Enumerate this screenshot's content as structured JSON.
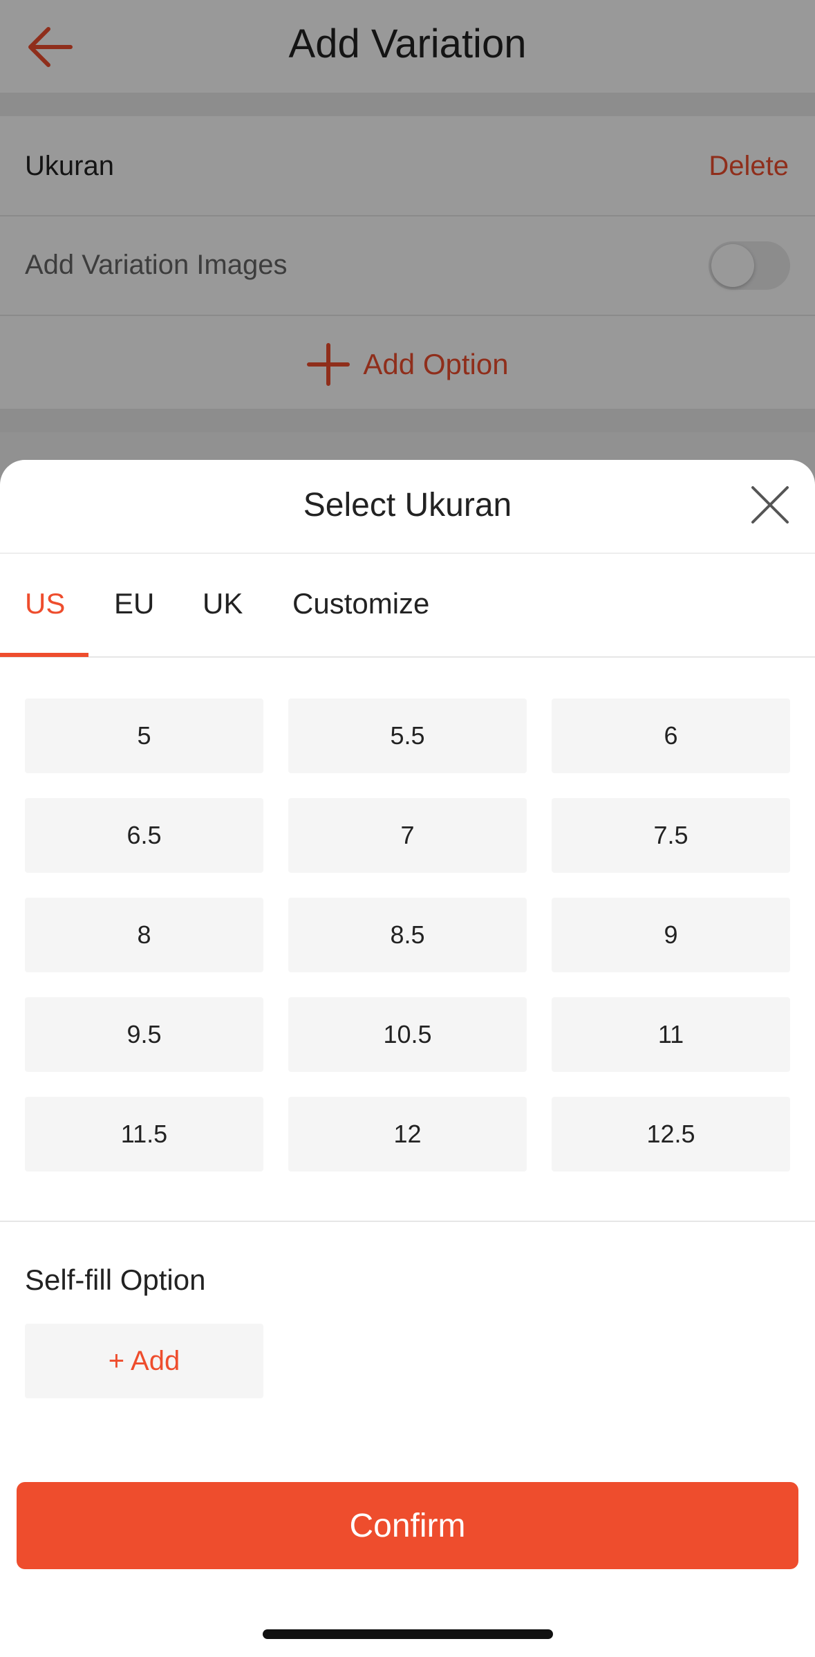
{
  "header": {
    "title": "Add Variation",
    "back_icon": "arrow-left-icon"
  },
  "variation": {
    "name": "Ukuran",
    "delete_label": "Delete",
    "images_label": "Add Variation Images",
    "images_toggle_on": false,
    "add_option_label": "Add Option"
  },
  "sheet": {
    "title": "Select Ukuran",
    "close_icon": "close-icon",
    "tabs": [
      {
        "label": "US",
        "active": true
      },
      {
        "label": "EU",
        "active": false
      },
      {
        "label": "UK",
        "active": false
      },
      {
        "label": "Customize",
        "active": false
      }
    ],
    "sizes": [
      "5",
      "5.5",
      "6",
      "6.5",
      "7",
      "7.5",
      "8",
      "8.5",
      "9",
      "9.5",
      "10.5",
      "11",
      "11.5",
      "12",
      "12.5"
    ],
    "self_fill_label": "Self-fill Option",
    "add_label": "+ Add",
    "confirm_label": "Confirm"
  },
  "colors": {
    "accent": "#ee4d2d"
  }
}
